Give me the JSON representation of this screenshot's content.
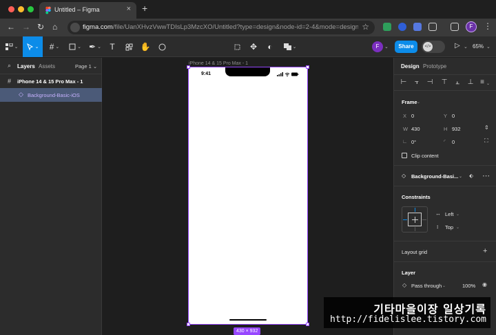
{
  "browser": {
    "tab_title": "Untitled – Figma",
    "tab_close": "×",
    "new_tab": "+",
    "url_host": "figma.com",
    "url_path": "/file/UanXHvzVwwTDIsLp3MzcXO/Untitled?type=design&node-id=2-4&mode=design&t...",
    "profile_initial": "F"
  },
  "toolbar": {
    "share_label": "Share",
    "avatar_initial": "F",
    "zoom": "65%"
  },
  "left_panel": {
    "tab_layers": "Layers",
    "tab_assets": "Assets",
    "page": "Page 1",
    "layers": [
      {
        "label": "iPhone 14 & 15 Pro Max - 1"
      },
      {
        "label": "Background-Basic-iOS"
      }
    ]
  },
  "canvas": {
    "frame_label": "iPhone 14 & 15 Pro Max - 1",
    "status_time": "9:41",
    "dimensions": "430 × 932"
  },
  "right_panel": {
    "tab_design": "Design",
    "tab_prototype": "Prototype",
    "frame_title": "Frame",
    "x_label": "X",
    "x_value": "0",
    "y_label": "Y",
    "y_value": "0",
    "w_label": "W",
    "w_value": "430",
    "h_label": "H",
    "h_value": "932",
    "rotation_value": "0°",
    "radius_value": "0",
    "clip_content": "Clip content",
    "component_name": "Background-Basi...",
    "constraints_title": "Constraints",
    "constraint_h": "Left",
    "constraint_v": "Top",
    "layout_grid": "Layout grid",
    "layer_title": "Layer",
    "blend_mode": "Pass through",
    "opacity": "100%"
  },
  "watermark": {
    "title": "기타마을이장 일상기록",
    "url": "http://fidelislee.tistory.com"
  },
  "colors": {
    "accent": "#0c8ce9",
    "selection": "#9747ff"
  }
}
